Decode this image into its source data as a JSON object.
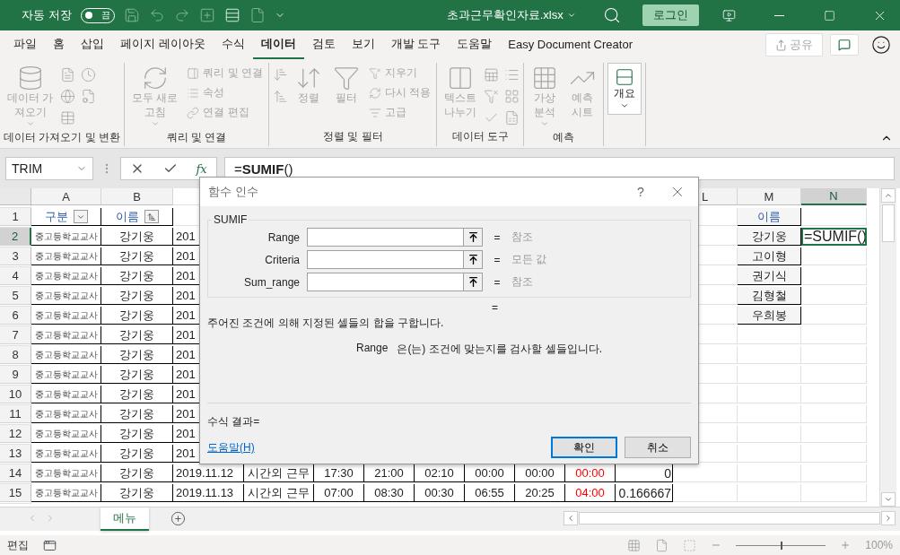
{
  "title_bar": {
    "autosave_label": "자동 저장",
    "autosave": {
      "on": false,
      "text": "끔"
    },
    "title": "초과근무확인자료.xlsx",
    "login": "로그인"
  },
  "menu": {
    "tabs": [
      {
        "label": "파일",
        "selected": false
      },
      {
        "label": "홈",
        "selected": false
      },
      {
        "label": "삽입",
        "selected": false
      },
      {
        "label": "페이지 레이아웃",
        "selected": false
      },
      {
        "label": "수식",
        "selected": false
      },
      {
        "label": "데이터",
        "selected": true
      },
      {
        "label": "검토",
        "selected": false
      },
      {
        "label": "보기",
        "selected": false
      },
      {
        "label": "개발 도구",
        "selected": false
      },
      {
        "label": "도움말",
        "selected": false
      },
      {
        "label": "Easy Document Creator",
        "selected": false
      }
    ],
    "share": {
      "label": "공유",
      "disabled": true
    }
  },
  "ribbon": {
    "groups": [
      {
        "label": "데이터 가져오기 및 변환",
        "items": [
          {
            "kind": "large",
            "lines": [
              "데이터 가",
              "져오기"
            ],
            "dropdown": true,
            "disabled": true
          },
          {
            "kind": "icons",
            "buttons": [
              {
                "disabled": true
              },
              {
                "disabled": true
              },
              {
                "disabled": true
              },
              {
                "disabled": true
              },
              {
                "disabled": true
              }
            ]
          }
        ]
      },
      {
        "label": "쿼리 및 연결",
        "items": [
          {
            "kind": "large",
            "lines": [
              "모두 새로",
              "고침"
            ],
            "dropdown": true,
            "disabled": true
          },
          {
            "kind": "smalls",
            "labels": [
              "쿼리 및 연결",
              "속성",
              "연결 편집"
            ],
            "disabled": true
          }
        ]
      },
      {
        "label": "정렬 및 필터",
        "items": [
          {
            "kind": "icons",
            "buttons": [
              {
                "disabled": true
              },
              {
                "disabled": true
              }
            ]
          },
          {
            "kind": "large",
            "lines": [
              "정렬"
            ],
            "dropdown": false,
            "disabled": true
          },
          {
            "kind": "large",
            "lines": [
              "필터"
            ],
            "dropdown": false,
            "disabled": true
          },
          {
            "kind": "smalls",
            "labels": [
              "지우기",
              "다시 적용",
              "고급"
            ],
            "disabled": true
          }
        ]
      },
      {
        "label": "데이터 도구",
        "items": [
          {
            "kind": "large",
            "lines": [
              "텍스트",
              "나누기"
            ],
            "dropdown": false,
            "disabled": true
          },
          {
            "kind": "icons",
            "buttons": [
              {
                "disabled": true
              },
              {
                "disabled": true
              },
              {
                "disabled": true
              },
              {
                "disabled": true
              },
              {
                "disabled": true
              },
              {
                "disabled": true
              }
            ]
          }
        ]
      },
      {
        "label": "예측",
        "items": [
          {
            "kind": "large",
            "lines": [
              "가상",
              "분석"
            ],
            "dropdown": true,
            "disabled": true
          },
          {
            "kind": "large",
            "lines": [
              "예측",
              "시트"
            ],
            "dropdown": false,
            "disabled": true
          }
        ]
      },
      {
        "items": [
          {
            "kind": "large",
            "lines": [
              "개요"
            ],
            "dropdown": true,
            "disabled": false
          }
        ]
      }
    ]
  },
  "formula_bar": {
    "name_box": "TRIM",
    "insert_function": "fx",
    "formula": "=**SUMIF**()"
  },
  "sheet": {
    "columns": [
      {
        "label": "A",
        "selected": false
      },
      {
        "label": "B",
        "selected": false
      },
      null,
      null,
      null,
      null,
      null,
      null,
      null,
      null,
      null,
      {
        "label": "L",
        "selected": false
      },
      {
        "label": "M",
        "selected": false
      },
      {
        "label": "N",
        "selected": true
      }
    ],
    "rows": [
      {
        "number": "1",
        "selected": false,
        "cells": {
          "A": {
            "text": "구분",
            "kind": "header",
            "filter": true,
            "sorted": false
          },
          "B": {
            "text": "이름",
            "kind": "header",
            "filter": true,
            "sorted": true
          },
          "M": {
            "text": "이름",
            "kind": "header-lookup"
          }
        }
      },
      {
        "number": "2",
        "selected": true,
        "cells": {
          "A": {
            "text": "중고등학교교사",
            "kind": "small"
          },
          "B": {
            "text": "강기웅",
            "kind": "name"
          },
          "C": {
            "text": "201",
            "kind": "date"
          },
          "M": {
            "text": "강기웅",
            "kind": "lookup"
          },
          "N": {
            "text": "=SUMIF()",
            "kind": "edit",
            "selected": true
          }
        }
      },
      {
        "number": "3",
        "selected": false,
        "cells": {
          "A": {
            "text": "중고등학교교사",
            "kind": "small"
          },
          "B": {
            "text": "강기웅",
            "kind": "name"
          },
          "C": {
            "text": "201",
            "kind": "date"
          },
          "M": {
            "text": "고이형",
            "kind": "lookup"
          }
        }
      },
      {
        "number": "4",
        "selected": false,
        "cells": {
          "A": {
            "text": "중고등학교교사",
            "kind": "small"
          },
          "B": {
            "text": "강기웅",
            "kind": "name"
          },
          "C": {
            "text": "201",
            "kind": "date"
          },
          "M": {
            "text": "권기식",
            "kind": "lookup"
          }
        }
      },
      {
        "number": "5",
        "selected": false,
        "cells": {
          "A": {
            "text": "중고등학교교사",
            "kind": "small"
          },
          "B": {
            "text": "강기웅",
            "kind": "name"
          },
          "C": {
            "text": "201",
            "kind": "date"
          },
          "M": {
            "text": "김형철",
            "kind": "lookup"
          }
        }
      },
      {
        "number": "6",
        "selected": false,
        "cells": {
          "A": {
            "text": "중고등학교교사",
            "kind": "small"
          },
          "B": {
            "text": "강기웅",
            "kind": "name"
          },
          "C": {
            "text": "201",
            "kind": "date"
          },
          "M": {
            "text": "우희봉",
            "kind": "lookup"
          }
        }
      },
      {
        "number": "7",
        "selected": false,
        "cells": {
          "A": {
            "text": "중고등학교교사",
            "kind": "small"
          },
          "B": {
            "text": "강기웅",
            "kind": "name"
          },
          "C": {
            "text": "201",
            "kind": "date"
          }
        }
      },
      {
        "number": "8",
        "selected": false,
        "cells": {
          "A": {
            "text": "중고등학교교사",
            "kind": "small"
          },
          "B": {
            "text": "강기웅",
            "kind": "name"
          },
          "C": {
            "text": "201",
            "kind": "date"
          }
        }
      },
      {
        "number": "9",
        "selected": false,
        "cells": {
          "A": {
            "text": "중고등학교교사",
            "kind": "small"
          },
          "B": {
            "text": "강기웅",
            "kind": "name"
          },
          "C": {
            "text": "201",
            "kind": "date"
          }
        }
      },
      {
        "number": "10",
        "selected": false,
        "cells": {
          "A": {
            "text": "중고등학교교사",
            "kind": "small"
          },
          "B": {
            "text": "강기웅",
            "kind": "name"
          },
          "C": {
            "text": "201",
            "kind": "date"
          }
        }
      },
      {
        "number": "11",
        "selected": false,
        "cells": {
          "A": {
            "text": "중고등학교교사",
            "kind": "small"
          },
          "B": {
            "text": "강기웅",
            "kind": "name"
          },
          "C": {
            "text": "201",
            "kind": "date"
          }
        }
      },
      {
        "number": "12",
        "selected": false,
        "cells": {
          "A": {
            "text": "중고등학교교사",
            "kind": "small"
          },
          "B": {
            "text": "강기웅",
            "kind": "name"
          },
          "C": {
            "text": "201",
            "kind": "date"
          }
        }
      },
      {
        "number": "13",
        "selected": false,
        "cells": {
          "A": {
            "text": "중고등학교교사",
            "kind": "small"
          },
          "B": {
            "text": "강기웅",
            "kind": "name"
          },
          "C": {
            "text": "201",
            "kind": "date"
          }
        }
      },
      {
        "number": "14",
        "selected": false,
        "cells": {
          "A": {
            "text": "중고등학교교사",
            "kind": "small"
          },
          "B": {
            "text": "강기웅",
            "kind": "name"
          },
          "C": {
            "text": "2019.11.12",
            "kind": "date"
          },
          "D": {
            "text": "시간외 근무",
            "kind": "name"
          },
          "E": {
            "text": "17:30",
            "kind": "time"
          },
          "F": {
            "text": "21:00",
            "kind": "time"
          },
          "G": {
            "text": "02:10",
            "kind": "time"
          },
          "H": {
            "text": "00:00",
            "kind": "time"
          },
          "I": {
            "text": "00:00",
            "kind": "time"
          },
          "J": {
            "text": "00:00",
            "kind": "time",
            "color": "#ff0000"
          },
          "K": {
            "text": "0",
            "kind": "value"
          }
        }
      },
      {
        "number": "15",
        "selected": false,
        "cells": {
          "A": {
            "text": "중고등학교교사",
            "kind": "small"
          },
          "B": {
            "text": "강기웅",
            "kind": "name"
          },
          "C": {
            "text": "2019.11.13",
            "kind": "date"
          },
          "D": {
            "text": "시간외 근무",
            "kind": "name"
          },
          "E": {
            "text": "07:00",
            "kind": "time"
          },
          "F": {
            "text": "08:30",
            "kind": "time"
          },
          "G": {
            "text": "00:30",
            "kind": "time"
          },
          "H": {
            "text": "06:55",
            "kind": "time"
          },
          "I": {
            "text": "20:25",
            "kind": "time"
          },
          "J": {
            "text": "04:00",
            "kind": "time",
            "color": "#ff0000"
          },
          "K": {
            "text": "0.166667",
            "kind": "value"
          }
        }
      }
    ]
  },
  "dialog": {
    "title": "함수 인수",
    "help": "?",
    "function": "SUMIF",
    "arguments": [
      {
        "name": "Range",
        "equals": "=",
        "result": "참조"
      },
      {
        "name": "Criteria",
        "equals": "=",
        "result": "모든 값"
      },
      {
        "name": "Sum_range",
        "equals": "=",
        "result": "참조"
      }
    ],
    "total": "=",
    "description": "주어진 조건에 의해 지정된 셀들의 합을 구합니다.",
    "arg_help": {
      "name": "Range",
      "text": "은(는) 조건에 맞는지를 검사할 셀들입니다."
    },
    "formula_result": "수식 결과=",
    "help_link": "도움말(H)",
    "buttons": [
      {
        "label": "확인",
        "default": true
      },
      {
        "label": "취소",
        "default": false
      }
    ]
  },
  "sheet_tabs": [
    {
      "label": "메뉴",
      "selected": true
    }
  ],
  "status_bar": {
    "mode": "편집",
    "zoom": {
      "level": 0.5,
      "reading": "100%"
    }
  }
}
